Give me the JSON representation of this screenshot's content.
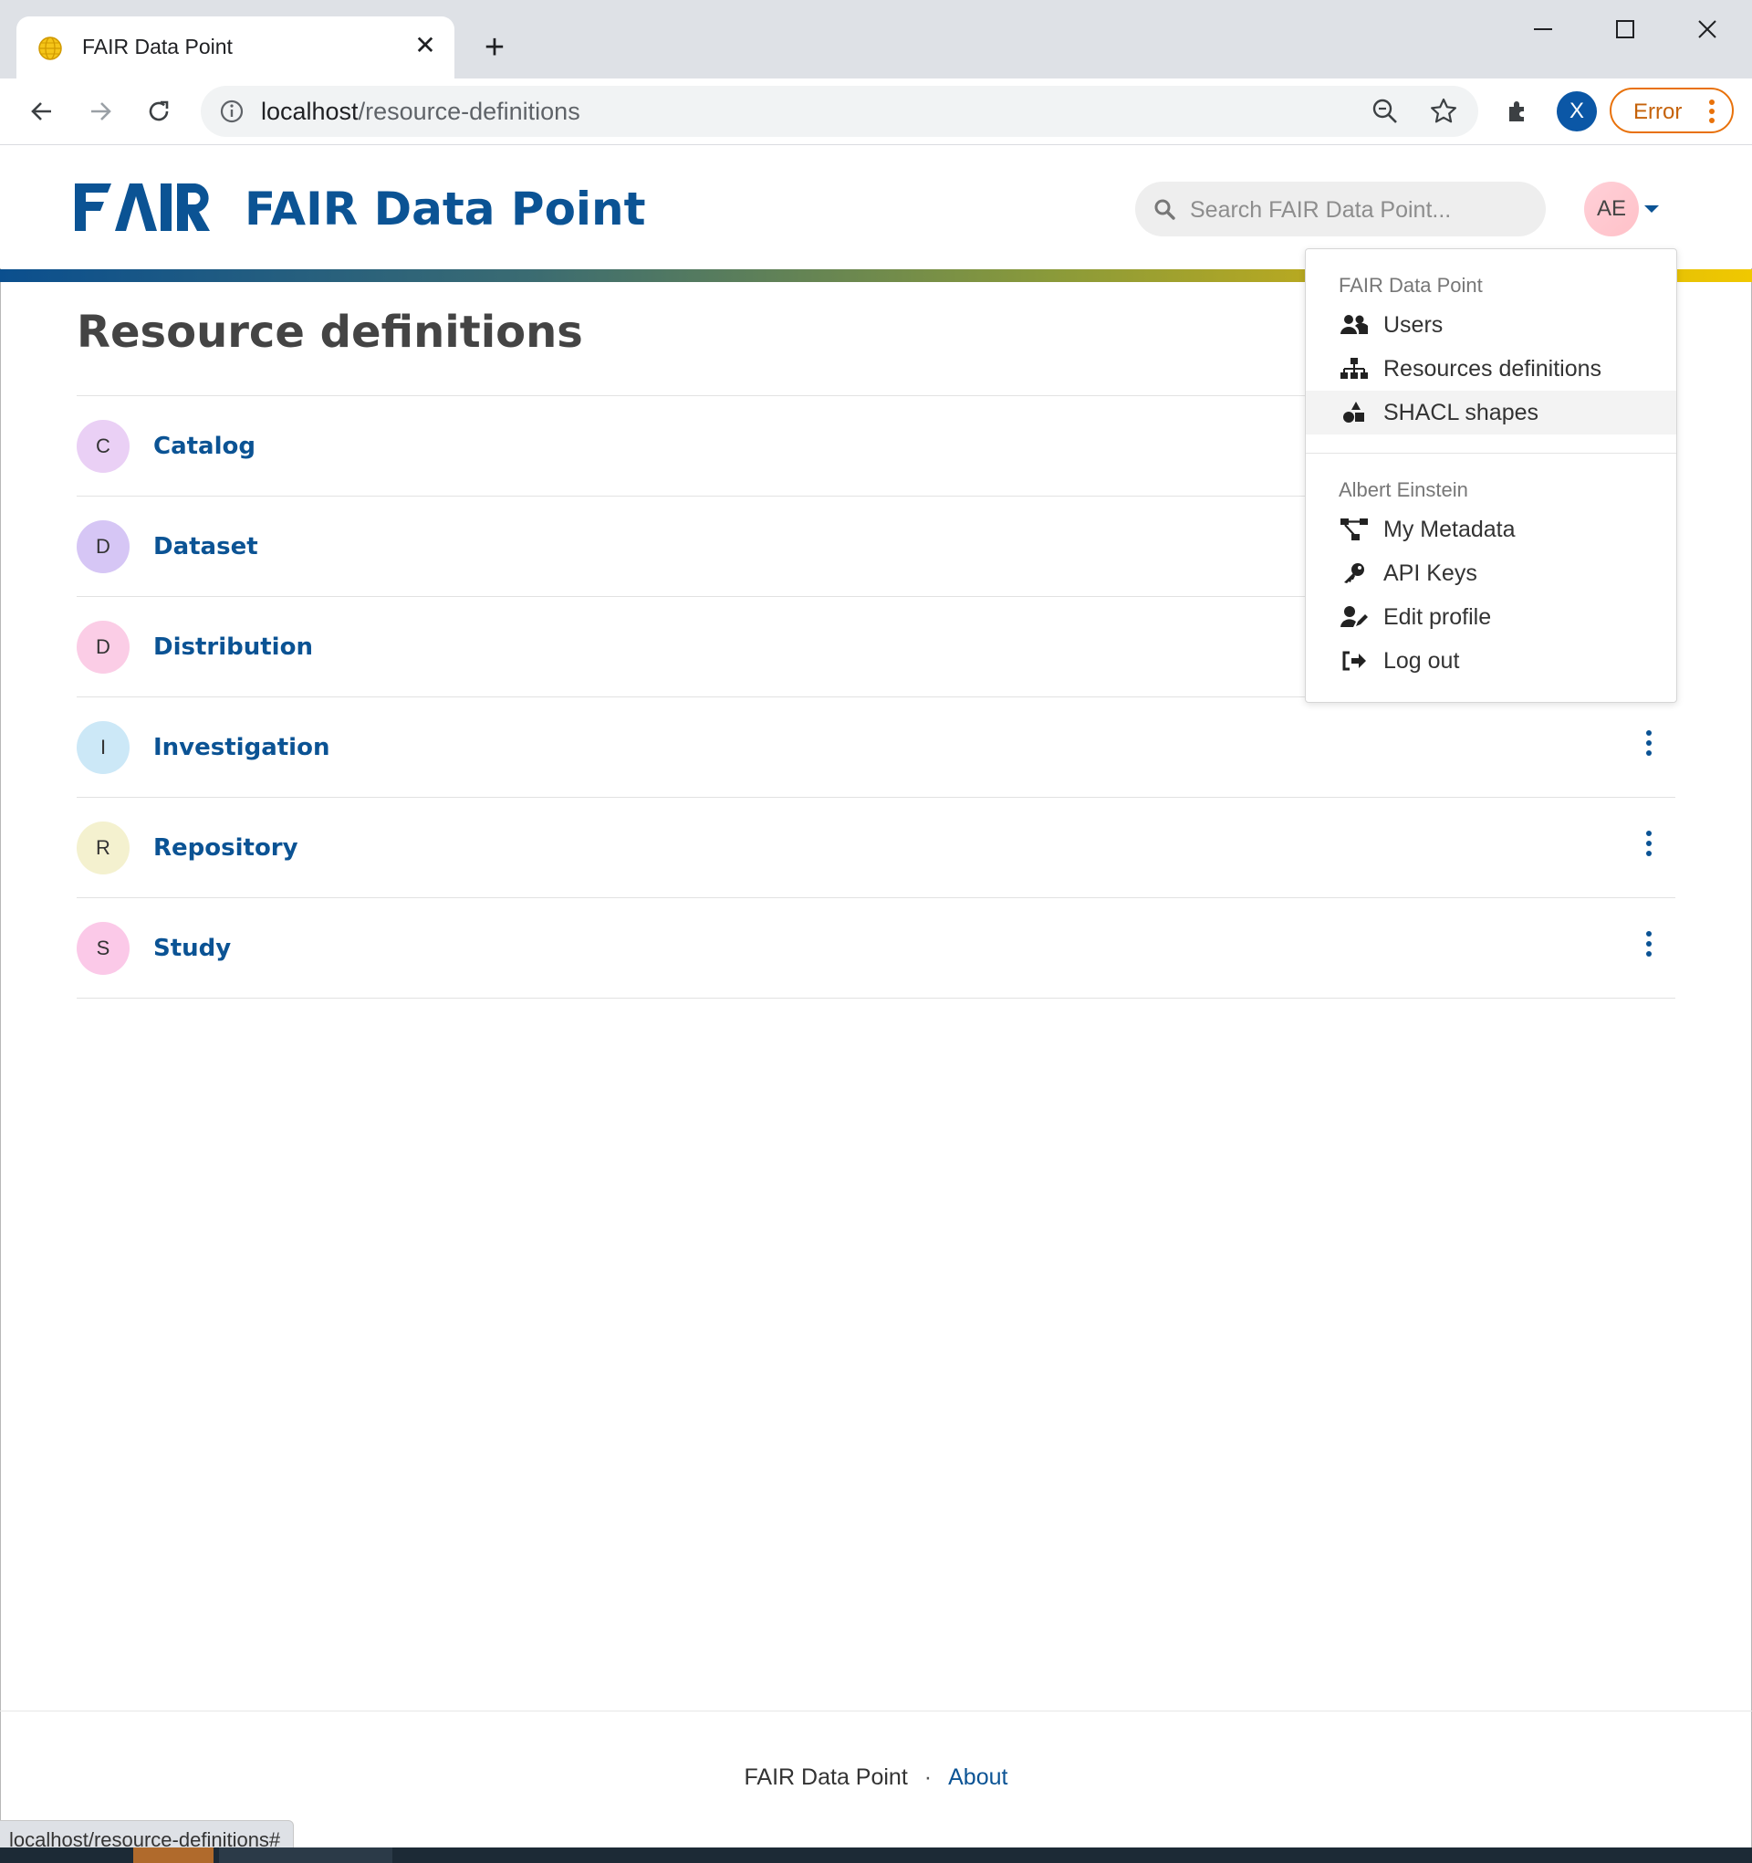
{
  "browser": {
    "tab_title": "FAIR Data Point",
    "url_host": "localhost",
    "url_path": "/resource-definitions",
    "profile_initial": "X",
    "error_label": "Error"
  },
  "header": {
    "app_title": "FAIR Data Point",
    "search_placeholder": "Search FAIR Data Point...",
    "avatar_initials": "AE"
  },
  "page": {
    "title": "Resource definitions",
    "items": [
      {
        "initial": "C",
        "name": "Catalog",
        "color": "#ead0f5"
      },
      {
        "initial": "D",
        "name": "Dataset",
        "color": "#d6c6f5"
      },
      {
        "initial": "D",
        "name": "Distribution",
        "color": "#fbcde6"
      },
      {
        "initial": "I",
        "name": "Investigation",
        "color": "#cce8f7"
      },
      {
        "initial": "R",
        "name": "Repository",
        "color": "#f4f1cf"
      },
      {
        "initial": "S",
        "name": "Study",
        "color": "#fbc9e8"
      }
    ]
  },
  "dropdown": {
    "section1_header": "FAIR Data Point",
    "section1_items": [
      {
        "label": "Users",
        "icon": "users-icon"
      },
      {
        "label": "Resources definitions",
        "icon": "sitemap-icon"
      },
      {
        "label": "SHACL shapes",
        "icon": "shapes-icon"
      }
    ],
    "section2_header": "Albert Einstein",
    "section2_items": [
      {
        "label": "My Metadata",
        "icon": "project-diagram-icon"
      },
      {
        "label": "API Keys",
        "icon": "key-icon"
      },
      {
        "label": "Edit profile",
        "icon": "user-edit-icon"
      },
      {
        "label": "Log out",
        "icon": "sign-out-icon"
      }
    ]
  },
  "footer": {
    "app_name": "FAIR Data Point",
    "about_link": "About"
  },
  "statusbar": {
    "text": "localhost/resource-definitions#"
  },
  "colors": {
    "brand": "#0b5394",
    "error": "#e8710a"
  }
}
